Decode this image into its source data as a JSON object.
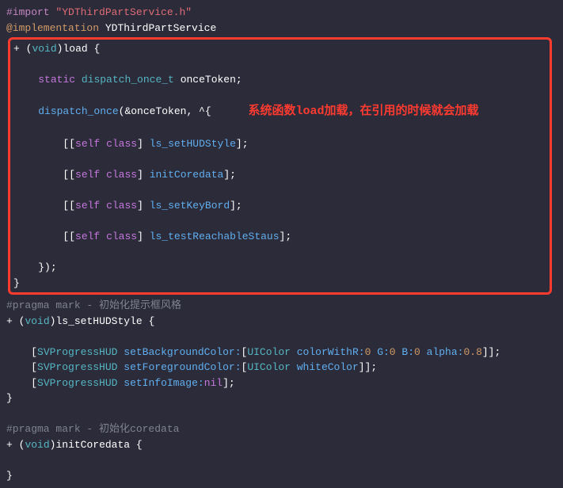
{
  "code": {
    "import_directive": "#import",
    "import_header": "\"YDThirdPartService.h\"",
    "impl_directive": "@implementation",
    "impl_class": "YDThirdPartService",
    "plus": "+",
    "lparen": "(",
    "rparen": ")",
    "void": "void",
    "method_load": "load",
    "lbrace": "{",
    "rbrace": "}",
    "static": "static",
    "dispatch_once_t": "dispatch_once_t",
    "onceToken": "onceToken",
    "semicolon": ";",
    "dispatch_once": "dispatch_once",
    "amp_once": "(&onceToken, ^{",
    "self": "self",
    "class": "class",
    "lbracket": "[[",
    "rbracket_mid": "]",
    "rbracket_end": "];",
    "m_ls_setHUDStyle": "ls_setHUDStyle",
    "m_initCoredata": "initCoredata",
    "m_ls_setKeyBord": "ls_setKeyBord",
    "m_ls_testReachableStaus": "ls_testReachableStaus",
    "block_close": "});",
    "pragma1": "#pragma",
    "pragma1_rest": " mark - 初始化提示框风格",
    "method_setHUDStyle": "ls_setHUDStyle",
    "SVProgressHUD": "SVProgressHUD",
    "setBackgroundColor": "setBackgroundColor:",
    "setForegroundColor": "setForegroundColor:",
    "setInfoImage": "setInfoImage:",
    "UIColor": "UIColor",
    "colorWithR": "colorWithR:",
    "G": "G:",
    "B": "B:",
    "alpha": "alpha:",
    "n0": "0",
    "n08": "0.8",
    "whiteColor": "whiteColor",
    "nil": "nil",
    "lb1": "[",
    "rb2": "]];",
    "pragma2_rest": " mark - 初始化coredata",
    "method_initCoredata": "initCoredata"
  },
  "annotation": "系统函数load加载，在引用的时候就会加载"
}
